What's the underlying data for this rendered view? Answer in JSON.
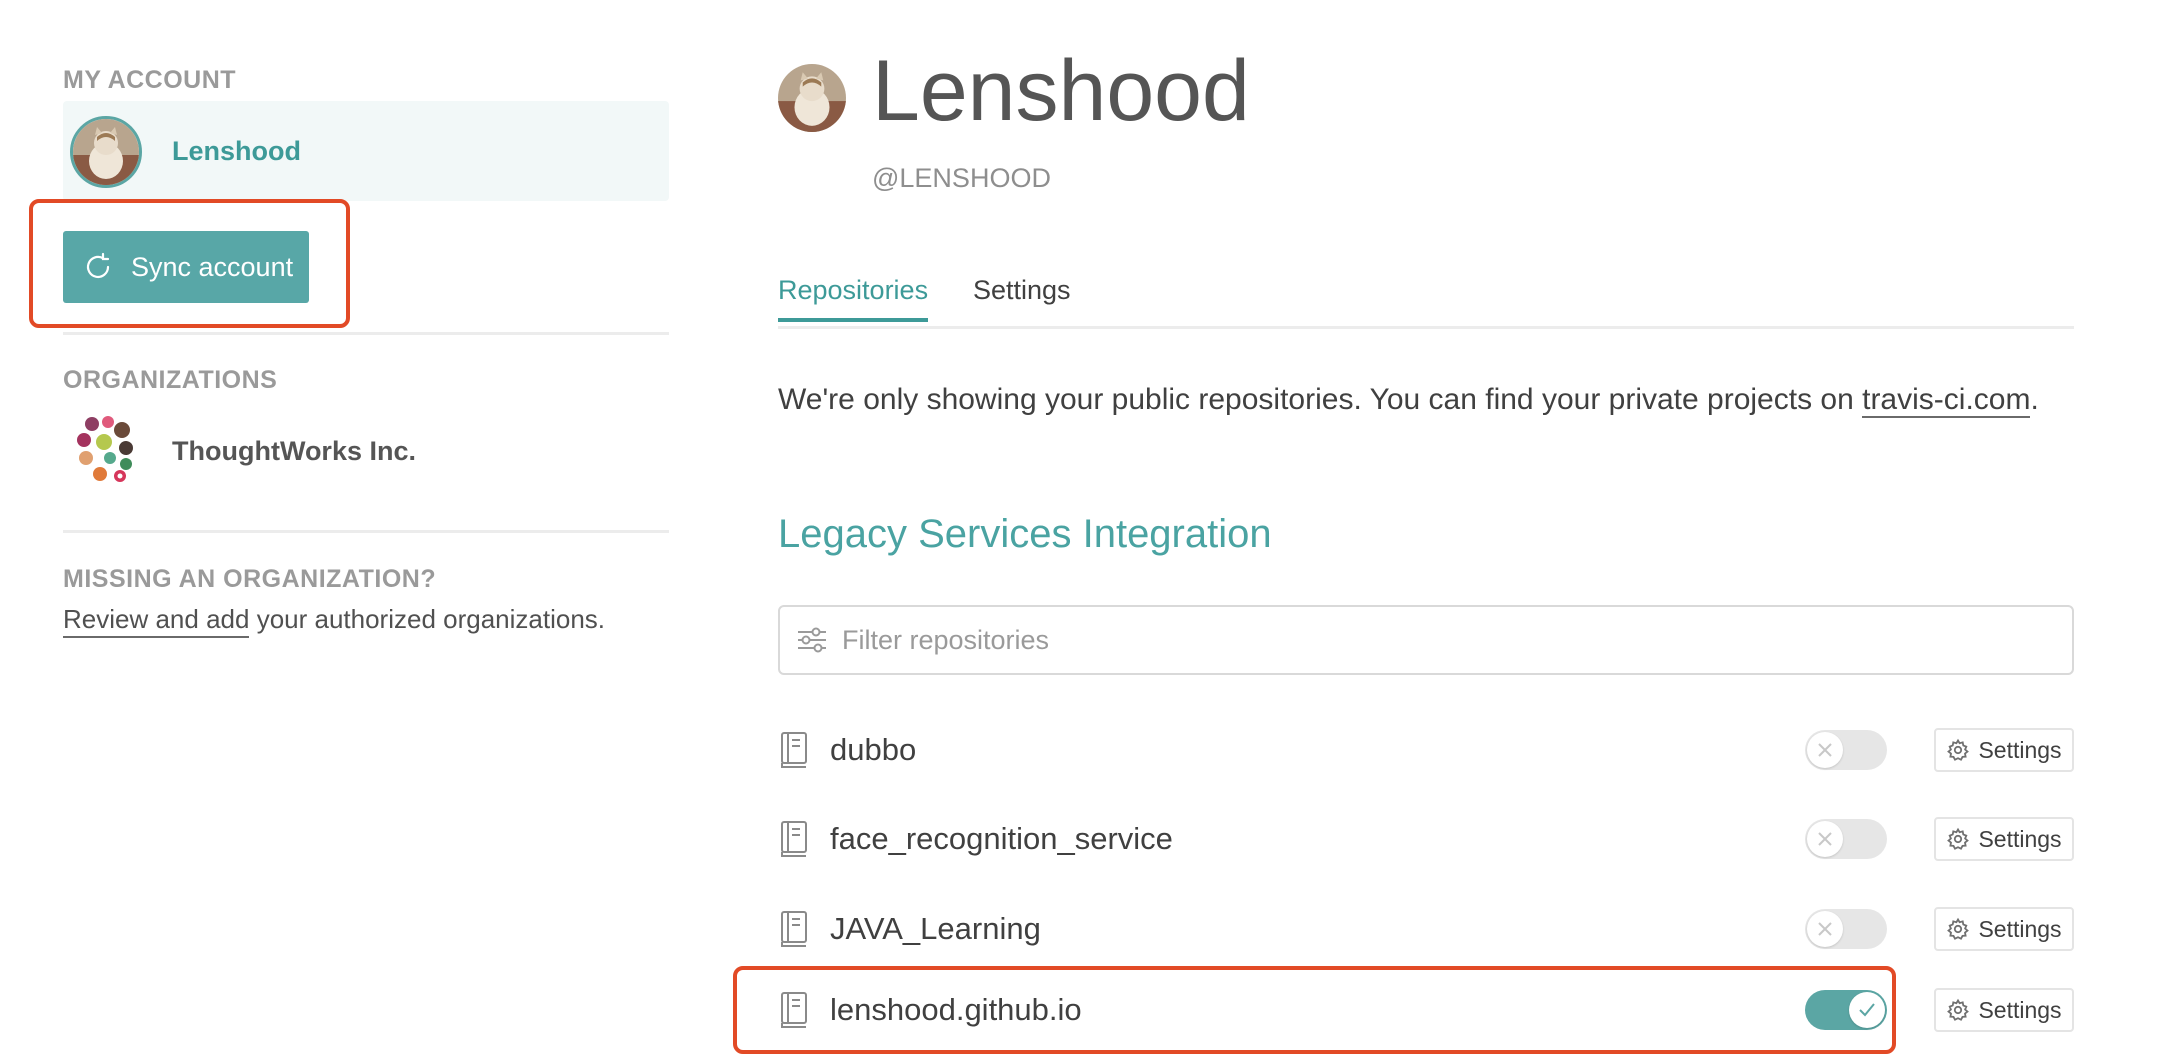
{
  "sidebar": {
    "my_account_title": "MY ACCOUNT",
    "account_name": "Lenshood",
    "sync_button_label": "Sync account",
    "organizations_title": "ORGANIZATIONS",
    "organization_name": "ThoughtWorks Inc.",
    "missing_title": "MISSING AN ORGANIZATION?",
    "missing_link": "Review and add",
    "missing_rest": " your authorized organizations."
  },
  "profile": {
    "name": "Lenshood",
    "handle": "@LENSHOOD"
  },
  "tabs": [
    {
      "label": "Repositories",
      "active": true
    },
    {
      "label": "Settings",
      "active": false
    }
  ],
  "info": {
    "text": "We're only showing your public repositories. You can find your private projects on ",
    "link": "travis-ci.com",
    "suffix": "."
  },
  "legacy": {
    "title": "Legacy Services Integration",
    "filter_placeholder": "Filter repositories"
  },
  "repositories": [
    {
      "name": "dubbo",
      "enabled": false,
      "settings_label": "Settings"
    },
    {
      "name": "face_recognition_service",
      "enabled": false,
      "settings_label": "Settings"
    },
    {
      "name": "JAVA_Learning",
      "enabled": false,
      "settings_label": "Settings"
    },
    {
      "name": "lenshood.github.io",
      "enabled": true,
      "settings_label": "Settings"
    }
  ],
  "colors": {
    "accent": "#3d9a98",
    "button": "#58a7a7",
    "highlight": "#e24a26",
    "toggle_on": "#5ba6a4",
    "toggle_off": "#e6e6e6"
  },
  "icons": {
    "sync": "sync-icon",
    "filter": "filter-icon",
    "repo": "repo-book-icon",
    "gear": "gear-icon",
    "toggle_off": "x-icon",
    "toggle_on": "check-icon"
  }
}
